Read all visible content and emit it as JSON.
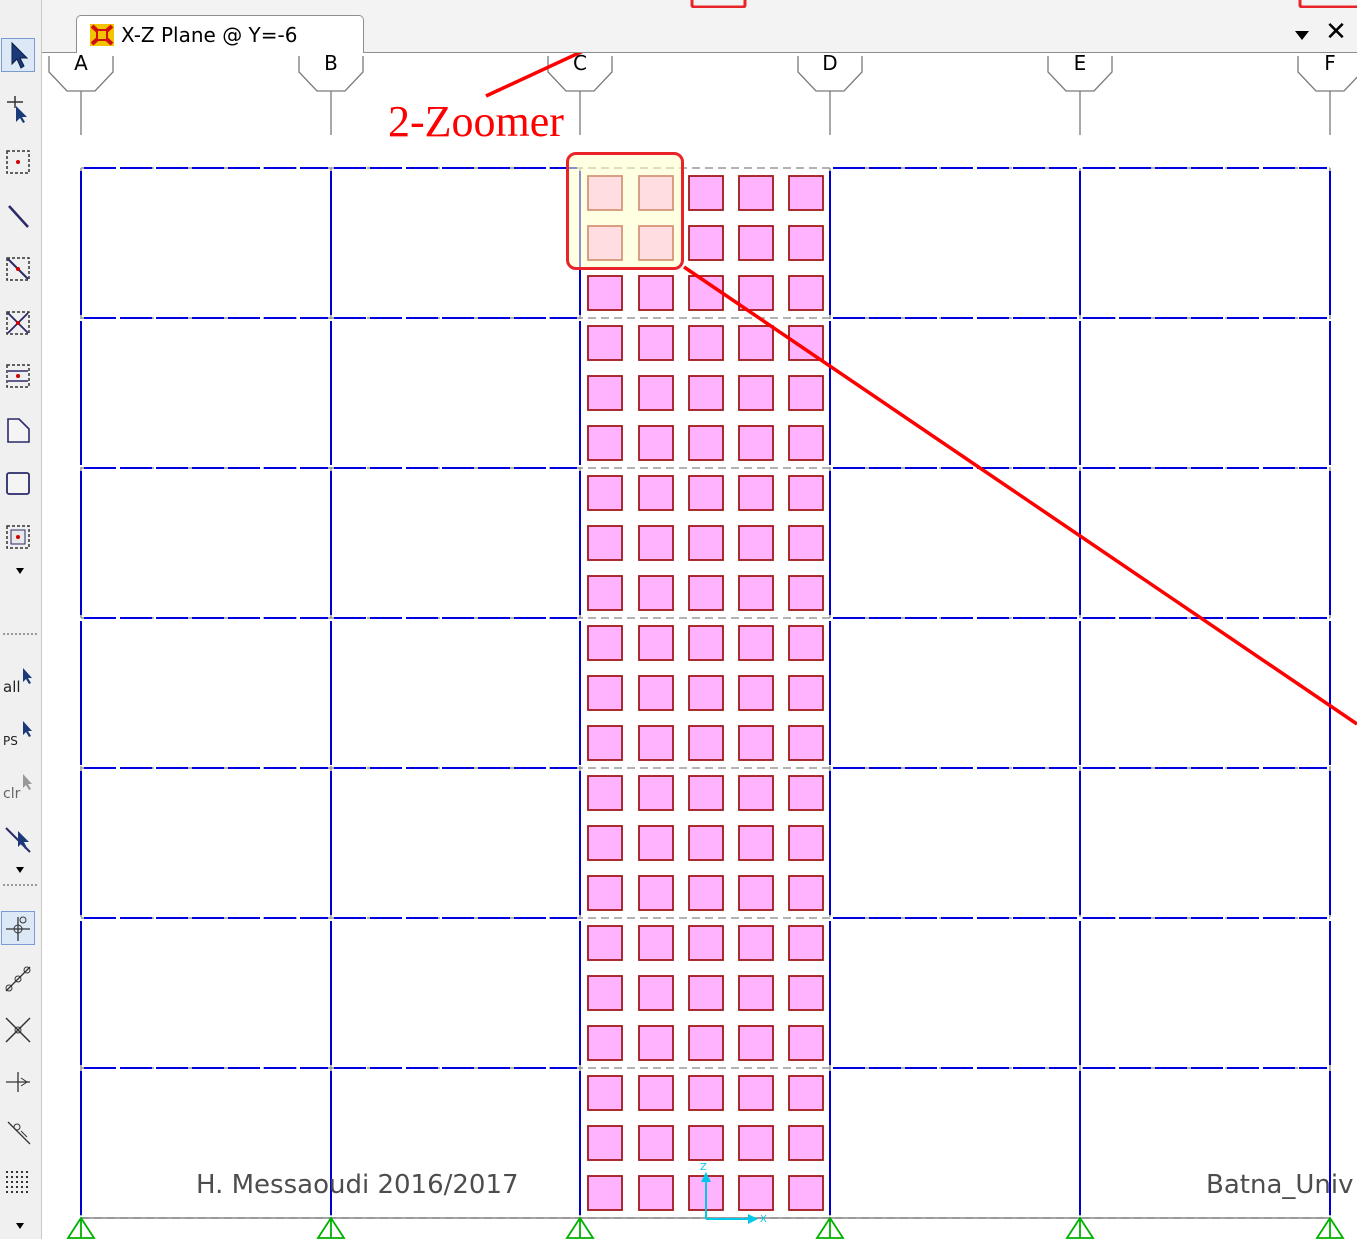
{
  "window": {
    "tab_title": "X-Z Plane @ Y=-6",
    "app_icon": "sap2000-icon",
    "dropdown_glyph": "▾",
    "close_glyph": "✕"
  },
  "toolbar": {
    "tools": [
      {
        "name": "pointer-tool-icon",
        "active": true
      },
      {
        "name": "draw-special-joint-icon"
      },
      {
        "name": "draw-joint-icon"
      },
      {
        "name": "draw-frame-icon"
      },
      {
        "name": "quick-draw-frame-icon"
      },
      {
        "name": "quick-draw-braces-icon"
      },
      {
        "name": "quick-draw-secondary-beams-icon"
      },
      {
        "name": "draw-poly-area-icon"
      },
      {
        "name": "draw-rectangular-area-icon"
      },
      {
        "name": "quick-draw-area-icon"
      }
    ],
    "select_tools": [
      {
        "name": "select-all-icon",
        "label": "all"
      },
      {
        "name": "get-previous-selection-icon",
        "label": "ps"
      },
      {
        "name": "clear-selection-icon",
        "label": "clr"
      },
      {
        "name": "intersecting-line-select-icon"
      }
    ],
    "snap_tools": [
      {
        "name": "snap-to-points-icon",
        "active": true
      },
      {
        "name": "snap-to-ends-midpoints-icon"
      },
      {
        "name": "snap-to-intersections-icon"
      },
      {
        "name": "snap-to-perpendicular-icon"
      },
      {
        "name": "snap-to-lines-edges-icon"
      },
      {
        "name": "snap-fine-grid-icon"
      }
    ]
  },
  "grid_bubbles": [
    "A",
    "B",
    "C",
    "D",
    "E",
    "F"
  ],
  "annotation": {
    "label": "2-Zoomer",
    "color": "#ff0000"
  },
  "footer": {
    "left_text": "H. Messaoudi 2016/2017",
    "right_text": "Batna_Univ"
  },
  "axes_labels": {
    "z": "Z",
    "x": "X"
  },
  "colors": {
    "beam": "#0000e0",
    "column": "#0000d0",
    "shell_fill": "#ffb3ff",
    "shell_border": "#a01818",
    "gridline": "#999999",
    "support": "#00b000",
    "annotation": "#ff0000"
  }
}
